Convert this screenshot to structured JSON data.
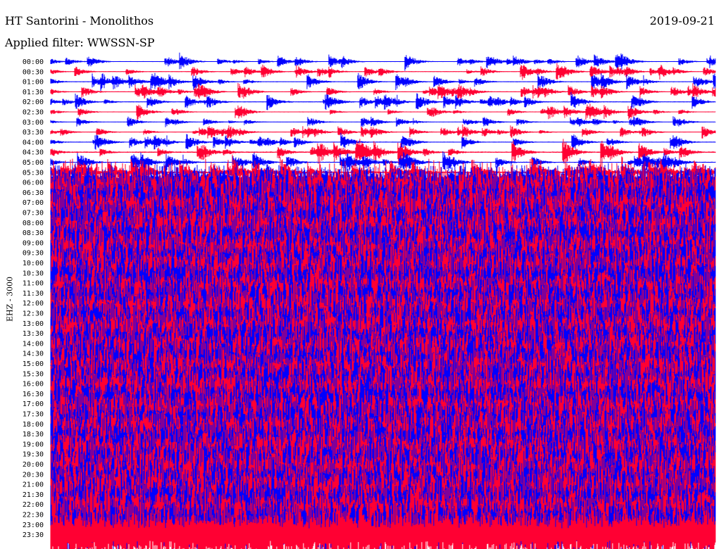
{
  "header": {
    "station": "HT Santorini - Monolithos",
    "date": "2019-09-21",
    "filter": "Applied filter: WWSSN-SP",
    "channel_label": "EHZ - 3000"
  },
  "colors": {
    "odd_trace": "#0000ff",
    "even_trace": "#ff0033",
    "background": "#ffffff"
  },
  "chart_data": {
    "type": "line",
    "title": "HT Santorini - Monolithos",
    "subtitle": "Applied filter: WWSSN-SP",
    "ylabel": "EHZ - 3000",
    "tick_labels": [
      "00:00",
      "00:30",
      "01:00",
      "01:30",
      "02:00",
      "02:30",
      "03:00",
      "03:30",
      "04:00",
      "04:30",
      "05:00",
      "05:30",
      "06:00",
      "06:30",
      "07:00",
      "07:30",
      "08:00",
      "08:30",
      "09:00",
      "09:30",
      "10:00",
      "10:30",
      "11:00",
      "11:30",
      "12:00",
      "12:30",
      "13:00",
      "13:30",
      "14:00",
      "14:30",
      "15:00",
      "15:30",
      "16:00",
      "16:30",
      "17:00",
      "17:30",
      "18:00",
      "18:30",
      "19:00",
      "19:30",
      "20:00",
      "20:30",
      "21:00",
      "21:30",
      "22:00",
      "22:30",
      "23:00",
      "23:30"
    ],
    "series": [
      {
        "values": [
          0.35,
          0.33,
          0.36,
          0.34,
          0.38,
          0.34,
          0.22,
          0.3,
          0.36,
          0.55,
          0.42,
          0.7,
          1.6,
          2.6,
          2.7,
          2.7,
          2.6,
          2.7,
          2.6,
          2.5,
          2.6,
          2.7,
          2.7,
          2.6,
          2.7,
          2.7,
          2.6,
          2.7,
          2.6,
          2.6,
          2.7,
          2.7,
          2.6,
          2.7,
          2.7,
          2.6,
          2.7,
          2.7,
          2.8,
          2.7,
          2.7,
          2.8,
          2.8,
          2.8,
          2.8,
          2.8,
          2.7,
          2.8
        ]
      }
    ],
    "grid": false,
    "legend": "none"
  }
}
